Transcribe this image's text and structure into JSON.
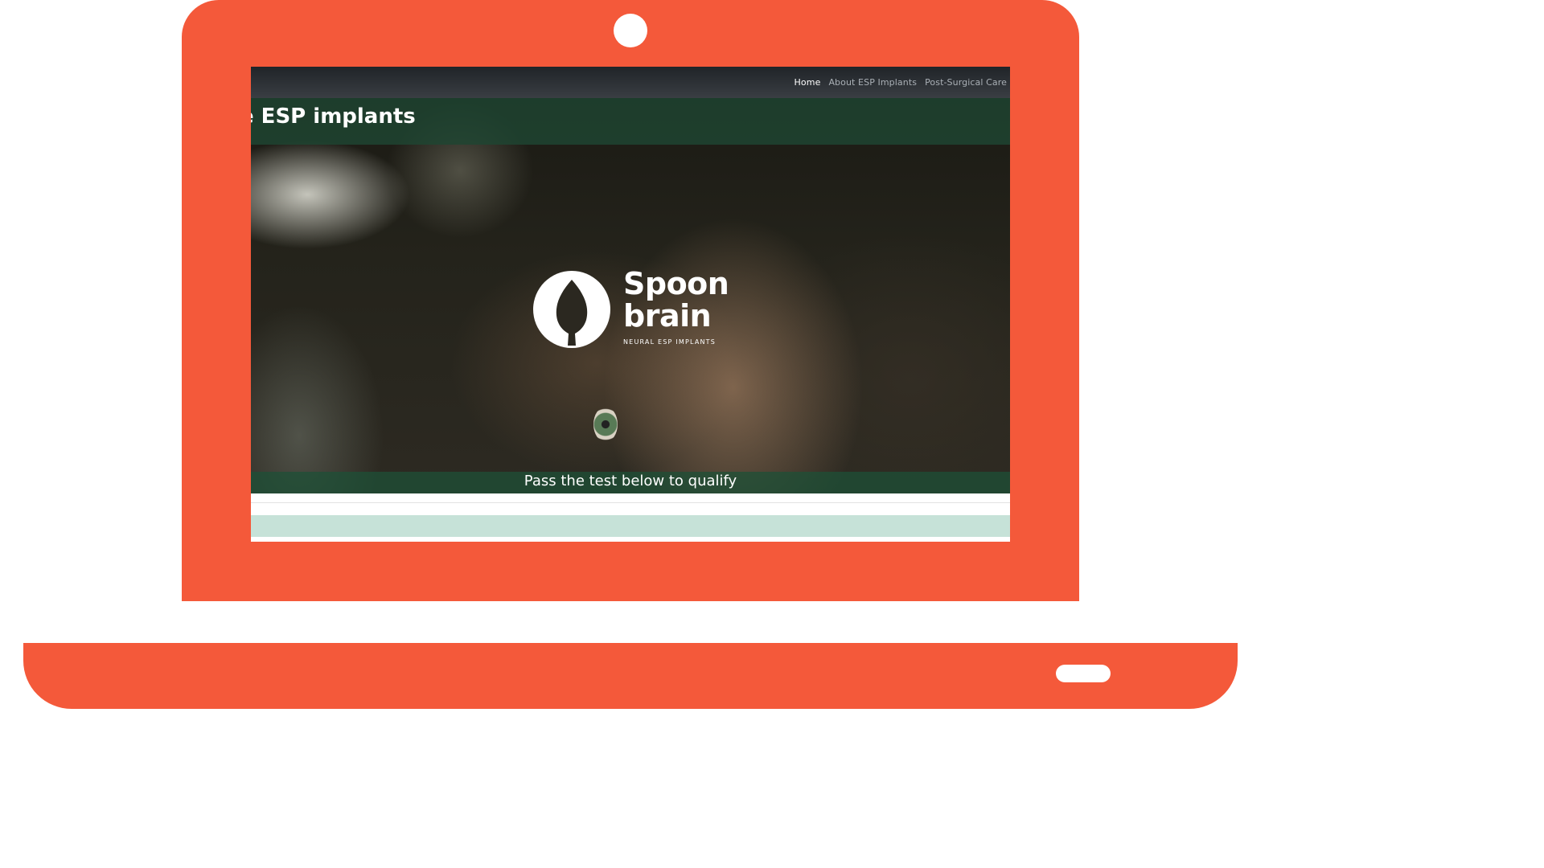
{
  "nav": {
    "items": [
      {
        "label": "Home",
        "active": true
      },
      {
        "label": "About ESP Implants",
        "active": false
      },
      {
        "label": "Post-Surgical Care",
        "active": false
      }
    ]
  },
  "hero": {
    "title": "e ESP implants",
    "logo": {
      "line1": "Spoon",
      "line2": "brain",
      "tagline": "NEURAL ESP IMPLANTS",
      "icon": "spoon-drop-icon"
    },
    "cta": "Pass the test below to qualify"
  },
  "colors": {
    "frame": "#f4593a",
    "nav_bg": "#2a2e33",
    "band": "#1e4632",
    "mint": "#c6e2d8"
  }
}
